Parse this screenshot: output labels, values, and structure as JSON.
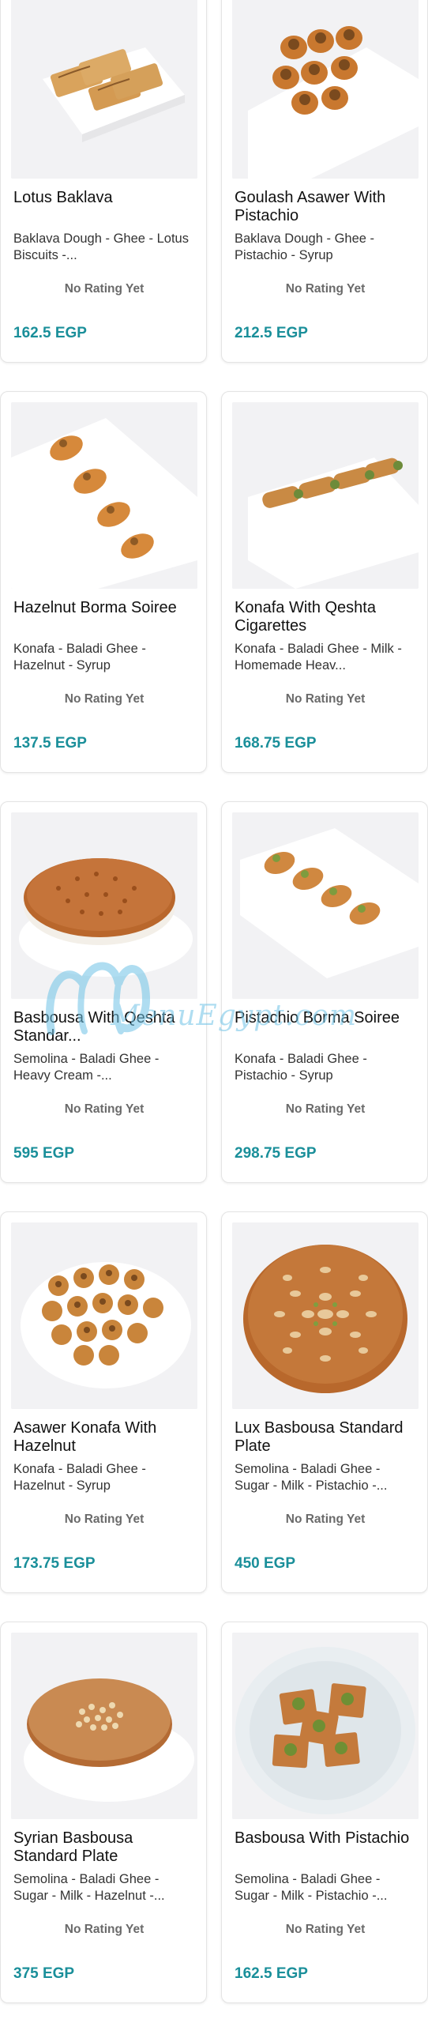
{
  "currency": "EGP",
  "watermark": {
    "text": "MenuEgypt.com"
  },
  "products": [
    {
      "name": "Lotus Baklava",
      "description": "Baklava Dough - Ghee - Lotus Biscuits -...",
      "rating": "No Rating Yet",
      "price": "162.5 EGP",
      "image_icon": "baklava-tray-icon"
    },
    {
      "name": "Goulash Asawer With Pistachio",
      "description": "Baklava Dough - Ghee - Pistachio - Syrup",
      "rating": "No Rating Yet",
      "price": "212.5 EGP",
      "image_icon": "asawer-pastry-icon"
    },
    {
      "name": "Hazelnut Borma Soiree",
      "description": "Konafa - Baladi Ghee - Hazelnut - Syrup",
      "rating": "No Rating Yet",
      "price": "137.5 EGP",
      "image_icon": "borma-pastry-icon"
    },
    {
      "name": "Konafa With Qeshta Cigarettes",
      "description": "Konafa - Baladi Ghee - Milk - Homemade Heav...",
      "rating": "No Rating Yet",
      "price": "168.75 EGP",
      "image_icon": "konafa-rolls-icon"
    },
    {
      "name": "Basbousa With Qeshta Standar...",
      "description": "Semolina - Baladi Ghee - Heavy Cream -...",
      "rating": "No Rating Yet",
      "price": "595 EGP",
      "image_icon": "basbousa-cake-icon"
    },
    {
      "name": "Pistachio Borma Soiree",
      "description": "Konafa - Baladi Ghee - Pistachio - Syrup",
      "rating": "No Rating Yet",
      "price": "298.75 EGP",
      "image_icon": "borma-pastry-icon"
    },
    {
      "name": "Asawer Konafa With Hazelnut",
      "description": "Konafa - Baladi Ghee - Hazelnut - Syrup",
      "rating": "No Rating Yet",
      "price": "173.75 EGP",
      "image_icon": "asawer-plate-icon"
    },
    {
      "name": "Lux Basbousa Standard Plate",
      "description": "Semolina - Baladi Ghee - Sugar - Milk - Pistachio -...",
      "rating": "No Rating Yet",
      "price": "450 EGP",
      "image_icon": "basbousa-nuts-icon"
    },
    {
      "name": "Syrian Basbousa Standard Plate",
      "description": "Semolina - Baladi Ghee - Sugar - Milk - Hazelnut -...",
      "rating": "No Rating Yet",
      "price": "375 EGP",
      "image_icon": "basbousa-crumb-icon"
    },
    {
      "name": "Basbousa With Pistachio",
      "description": "Semolina - Baladi Ghee - Sugar - Milk - Pistachio -...",
      "rating": "No Rating Yet",
      "price": "162.5 EGP",
      "image_icon": "basbousa-squares-icon"
    }
  ]
}
